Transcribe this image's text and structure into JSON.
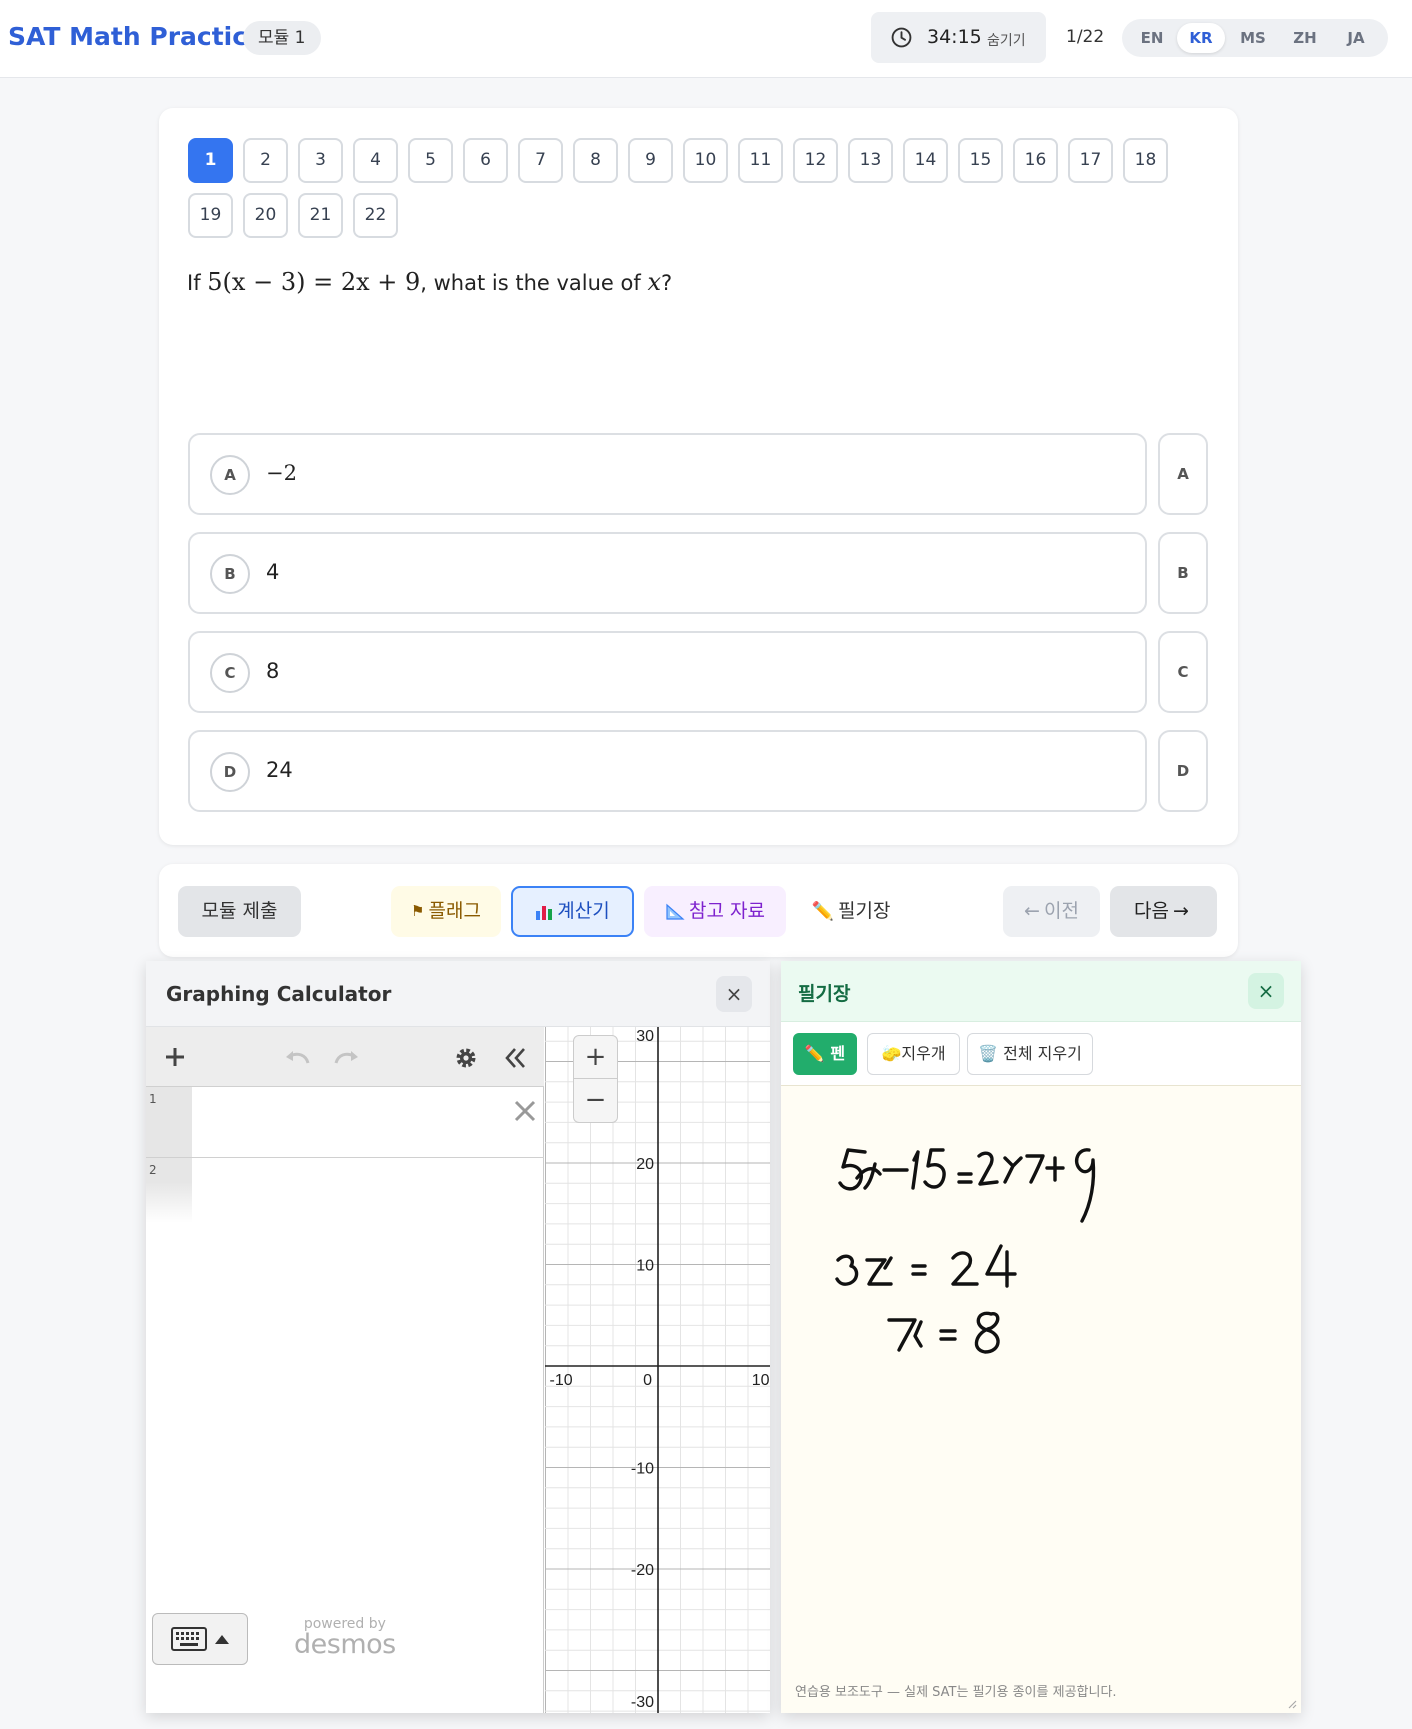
{
  "header": {
    "brand": "SAT Math Practice",
    "module": "모듈 1",
    "timer": "34:15",
    "timer_hide": "숨기기",
    "progress": "1/22",
    "languages": [
      "EN",
      "KR",
      "MS",
      "ZH",
      "JA"
    ],
    "active_language": "KR"
  },
  "navigator": {
    "numbers": [
      "1",
      "2",
      "3",
      "4",
      "5",
      "6",
      "7",
      "8",
      "9",
      "10",
      "11",
      "12",
      "13",
      "14",
      "15",
      "16",
      "17",
      "18",
      "19",
      "20",
      "21",
      "22"
    ],
    "current": "1"
  },
  "question": {
    "prefix": "If",
    "equation": "5(x − 3) = 2x + 9",
    "suffix": ", what is the value of",
    "var": "x",
    "end": "?"
  },
  "choices": [
    {
      "letter": "A",
      "value": "−2"
    },
    {
      "letter": "B",
      "value": "4"
    },
    {
      "letter": "C",
      "value": "8"
    },
    {
      "letter": "D",
      "value": "24"
    }
  ],
  "toolbar": {
    "submit": "모듈 제출",
    "flag": "플래그",
    "calculator": "계산기",
    "reference": "참고 자료",
    "scratchpad": "필기장",
    "prev": "이전",
    "next": "다음"
  },
  "calculator": {
    "title": "Graphing Calculator",
    "close": "×",
    "rows": [
      "1",
      "2"
    ],
    "x_ticks": [
      "-10",
      "0",
      "10"
    ],
    "y_ticks": [
      "30",
      "20",
      "10",
      "-10",
      "-20",
      "-30"
    ],
    "powered_by": "powered by",
    "brand": "desmos"
  },
  "scratchpad": {
    "title": "필기장",
    "close": "×",
    "pen": "펜",
    "eraser": "지우개",
    "clear_all": "전체 지우기",
    "handwriting": [
      "5x−15 = 2x+9",
      "3x = 24",
      "x = 8"
    ],
    "footer": "연습용 보조도구 — 실제 SAT는 필기용 종이를 제공합니다."
  }
}
